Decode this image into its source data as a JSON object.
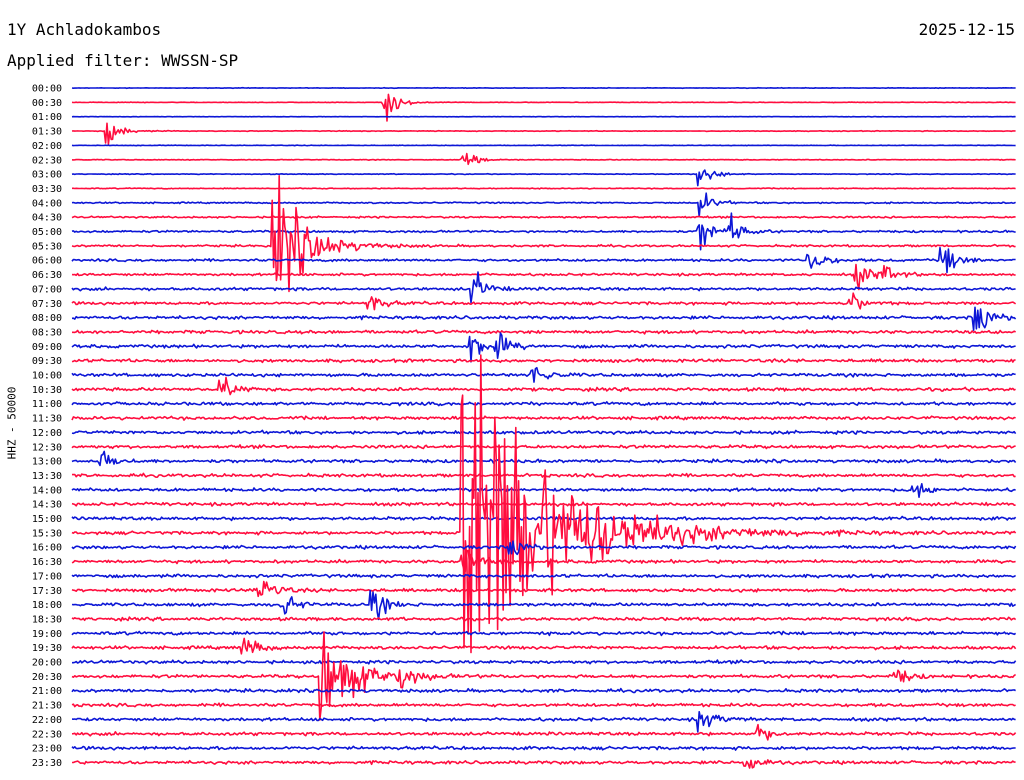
{
  "header": {
    "station": "1Y Achladokambos",
    "date": "2025-12-15",
    "filter": "Applied filter: WWSSN-SP"
  },
  "chart_data": {
    "type": "line",
    "title": "1Y Achladokambos",
    "subtitle": "Applied filter: WWSSN-SP",
    "ylabel": "HHZ - 50000",
    "date": "2025-12-15",
    "row_labels": [
      "00:00",
      "00:30",
      "01:00",
      "01:30",
      "02:00",
      "02:30",
      "03:00",
      "03:30",
      "04:00",
      "04:30",
      "05:00",
      "05:30",
      "06:00",
      "06:30",
      "07:00",
      "07:30",
      "08:00",
      "08:30",
      "09:00",
      "09:30",
      "10:00",
      "10:30",
      "11:00",
      "11:30",
      "12:00",
      "12:30",
      "13:00",
      "13:30",
      "14:00",
      "14:30",
      "15:00",
      "15:30",
      "16:00",
      "16:30",
      "17:00",
      "17:30",
      "18:00",
      "18:30",
      "19:00",
      "19:30",
      "20:00",
      "20:30",
      "21:00",
      "21:30",
      "22:00",
      "22:30",
      "23:00",
      "23:30"
    ],
    "colors": [
      "#0c16d6",
      "#ff0d3e"
    ],
    "row_minutes": 30,
    "noise_level": [
      0.15,
      0.15,
      0.1,
      0.2,
      0.15,
      0.2,
      0.2,
      0.25,
      0.4,
      0.5,
      0.6,
      0.6,
      0.7,
      0.7,
      0.8,
      0.8,
      0.9,
      0.9,
      0.9,
      0.9,
      0.9,
      0.9,
      0.9,
      0.9,
      0.9,
      0.9,
      0.9,
      0.9,
      0.9,
      0.9,
      0.9,
      0.9,
      0.9,
      0.9,
      0.9,
      0.9,
      0.9,
      0.9,
      0.9,
      0.9,
      0.9,
      0.9,
      0.9,
      0.9,
      0.9,
      0.9,
      0.9,
      0.9
    ],
    "events": [
      {
        "row": 1,
        "minute": 10.0,
        "amp": 2.5
      },
      {
        "row": 3,
        "minute": 1.2,
        "amp": 2.0
      },
      {
        "row": 5,
        "minute": 12.5,
        "amp": 1.5
      },
      {
        "row": 6,
        "minute": 20.0,
        "amp": 2.0
      },
      {
        "row": 8,
        "minute": 20.0,
        "amp": 2.0
      },
      {
        "row": 10,
        "minute": 20.0,
        "amp": 3.0
      },
      {
        "row": 10,
        "minute": 21.0,
        "amp": 2.0
      },
      {
        "row": 11,
        "minute": 6.5,
        "amp": 10.0
      },
      {
        "row": 12,
        "minute": 23.5,
        "amp": 2.0
      },
      {
        "row": 12,
        "minute": 27.7,
        "amp": 3.0
      },
      {
        "row": 13,
        "minute": 25.0,
        "amp": 2.0
      },
      {
        "row": 13,
        "minute": 25.8,
        "amp": 1.5
      },
      {
        "row": 14,
        "minute": 12.8,
        "amp": 2.5
      },
      {
        "row": 15,
        "minute": 9.5,
        "amp": 1.5
      },
      {
        "row": 15,
        "minute": 24.8,
        "amp": 1.5
      },
      {
        "row": 16,
        "minute": 28.8,
        "amp": 3.5
      },
      {
        "row": 18,
        "minute": 12.7,
        "amp": 3.0
      },
      {
        "row": 18,
        "minute": 13.5,
        "amp": 2.0
      },
      {
        "row": 20,
        "minute": 14.7,
        "amp": 2.0
      },
      {
        "row": 21,
        "minute": 4.8,
        "amp": 2.0
      },
      {
        "row": 26,
        "minute": 1.0,
        "amp": 1.5
      },
      {
        "row": 28,
        "minute": 26.8,
        "amp": 1.5
      },
      {
        "row": 31,
        "minute": 12.5,
        "amp": 35.0
      },
      {
        "row": 32,
        "minute": 14.0,
        "amp": 2.0
      },
      {
        "row": 33,
        "minute": 12.5,
        "amp": 3.0
      },
      {
        "row": 35,
        "minute": 6.0,
        "amp": 3.0
      },
      {
        "row": 36,
        "minute": 6.7,
        "amp": 2.0
      },
      {
        "row": 36,
        "minute": 9.6,
        "amp": 2.5
      },
      {
        "row": 39,
        "minute": 5.5,
        "amp": 2.0
      },
      {
        "row": 41,
        "minute": 8.0,
        "amp": 8.0
      },
      {
        "row": 41,
        "minute": 10.5,
        "amp": 1.5
      },
      {
        "row": 41,
        "minute": 26.2,
        "amp": 1.5
      },
      {
        "row": 44,
        "minute": 20.0,
        "amp": 2.0
      },
      {
        "row": 45,
        "minute": 21.8,
        "amp": 1.5
      },
      {
        "row": 47,
        "minute": 21.5,
        "amp": 1.5
      }
    ]
  }
}
